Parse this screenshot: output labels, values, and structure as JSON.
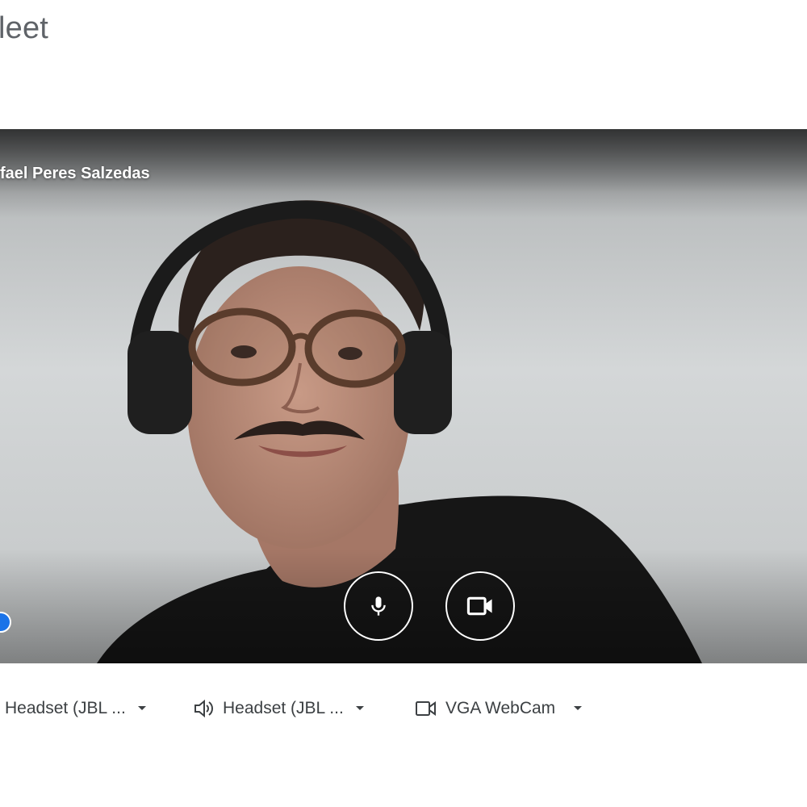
{
  "app": {
    "title": "leet"
  },
  "preview": {
    "participant_name": "fael Peres Salzedas",
    "mic_icon": "microphone-icon",
    "camera_icon": "videocam-icon"
  },
  "devices": {
    "microphone": {
      "label": "Headset (JBL ...",
      "icon": "microphone-icon"
    },
    "speaker": {
      "label": "Headset (JBL ...",
      "icon": "speaker-icon"
    },
    "camera": {
      "label": "VGA WebCam",
      "icon": "videocam-icon"
    }
  },
  "colors": {
    "accent": "#1a73e8",
    "text": "#3c4043"
  }
}
